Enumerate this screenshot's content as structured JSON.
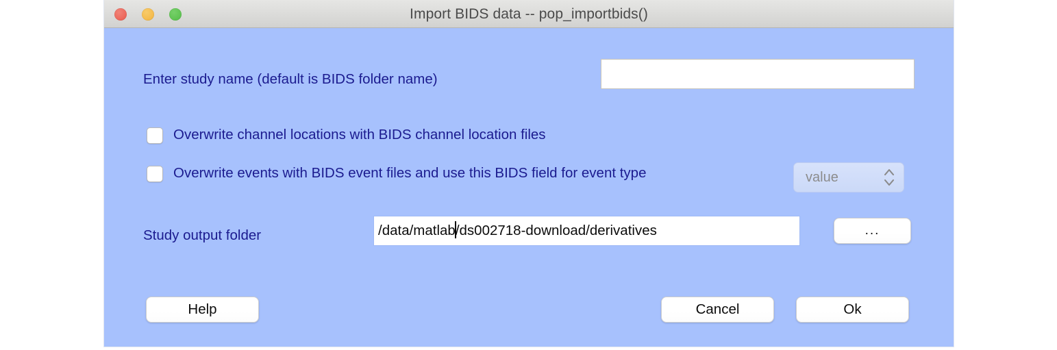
{
  "window": {
    "title": "Import BIDS data -- pop_importbids()",
    "background_color": "#a7c1fd",
    "label_color": "#1b1b8f",
    "traffic_lights": {
      "close_color": "#ed6a5e",
      "minimize_color": "#f5bd4f",
      "maximize_color": "#61c554"
    }
  },
  "form": {
    "study_name": {
      "label": "Enter study name (default is BIDS folder name)",
      "value": "",
      "placeholder": ""
    },
    "overwrite_channels": {
      "label": "Overwrite channel locations with BIDS channel location files",
      "checked": false
    },
    "overwrite_events": {
      "label": "Overwrite events with BIDS event files and use this BIDS field for event type",
      "checked": false
    },
    "event_field_select": {
      "value": "value",
      "enabled": false
    },
    "output_folder": {
      "label": "Study output folder",
      "value": "/data/matlab/ds002718-download/derivatives",
      "caret_after": "/data/matlab",
      "caret_before": "/ds002718-download/derivatives"
    },
    "browse_button_label": "..."
  },
  "buttons": {
    "help": "Help",
    "cancel": "Cancel",
    "ok": "Ok"
  }
}
